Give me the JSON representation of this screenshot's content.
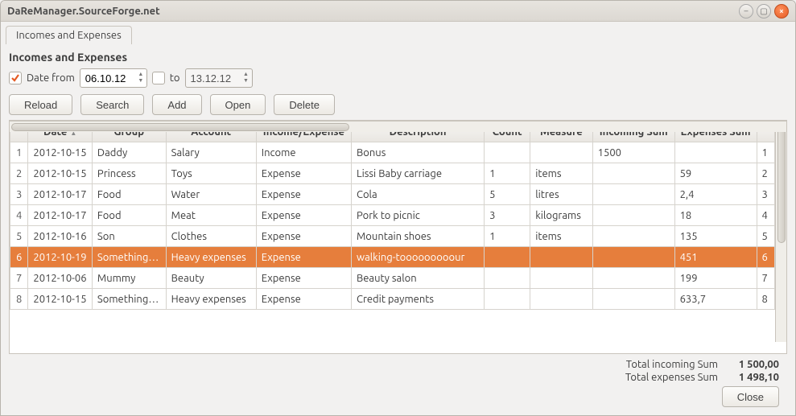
{
  "window": {
    "title": "DaReManager.SourceForge.net"
  },
  "tab": {
    "label": "Incomes and Expenses"
  },
  "section": {
    "title": "Incomes and Expenses"
  },
  "filters": {
    "date_from_label": "Date from",
    "date_from_value": "06.10.12",
    "to_label": "to",
    "date_to_value": "13.12.12"
  },
  "toolbar": {
    "reload": "Reload",
    "search": "Search",
    "add": "Add",
    "open": "Open",
    "delete": "Delete"
  },
  "columns": {
    "date": "Date",
    "group": "Group",
    "account": "Account",
    "type": "Income/Expense",
    "description": "Description",
    "count": "Count",
    "measure": "Measure",
    "incoming": "Incoming Sum",
    "expenses": "Expenses Sum"
  },
  "rows": [
    {
      "n": "1",
      "date": "2012-10-15",
      "group": "Daddy",
      "account": "Salary",
      "type": "Income",
      "desc": "Bonus",
      "count": "",
      "measure": "",
      "incoming": "1500",
      "expenses": "",
      "id": "1"
    },
    {
      "n": "2",
      "date": "2012-10-15",
      "group": "Princess",
      "account": "Toys",
      "type": "Expense",
      "desc": "Lissi Baby carriage",
      "count": "1",
      "measure": "items",
      "incoming": "",
      "expenses": "59",
      "id": "2"
    },
    {
      "n": "3",
      "date": "2012-10-17",
      "group": "Food",
      "account": "Water",
      "type": "Expense",
      "desc": "Cola",
      "count": "5",
      "measure": "litres",
      "incoming": "",
      "expenses": "2,4",
      "id": "3"
    },
    {
      "n": "4",
      "date": "2012-10-17",
      "group": "Food",
      "account": "Meat",
      "type": "Expense",
      "desc": "Pork to picnic",
      "count": "3",
      "measure": "kilograms",
      "incoming": "",
      "expenses": "18",
      "id": "4"
    },
    {
      "n": "5",
      "date": "2012-10-16",
      "group": "Son",
      "account": "Clothes",
      "type": "Expense",
      "desc": "Mountain shoes",
      "count": "1",
      "measure": "items",
      "incoming": "",
      "expenses": "135",
      "id": "5"
    },
    {
      "n": "6",
      "date": "2012-10-19",
      "group": "Something…",
      "account": "Heavy expenses",
      "type": "Expense",
      "desc": "walking-tooooooooour",
      "count": "",
      "measure": "",
      "incoming": "",
      "expenses": "451",
      "id": "6",
      "selected": true
    },
    {
      "n": "7",
      "date": "2012-10-06",
      "group": "Mummy",
      "account": "Beauty",
      "type": "Expense",
      "desc": "Beauty salon",
      "count": "",
      "measure": "",
      "incoming": "",
      "expenses": "199",
      "id": "7"
    },
    {
      "n": "8",
      "date": "2012-10-15",
      "group": "Something…",
      "account": "Heavy expenses",
      "type": "Expense",
      "desc": "Credit payments",
      "count": "",
      "measure": "",
      "incoming": "",
      "expenses": "633,7",
      "id": "8"
    }
  ],
  "totals": {
    "incoming_label": "Total incoming Sum",
    "incoming_value": "1 500,00",
    "expenses_label": "Total expenses Sum",
    "expenses_value": "1 498,10"
  },
  "footer": {
    "close": "Close"
  }
}
